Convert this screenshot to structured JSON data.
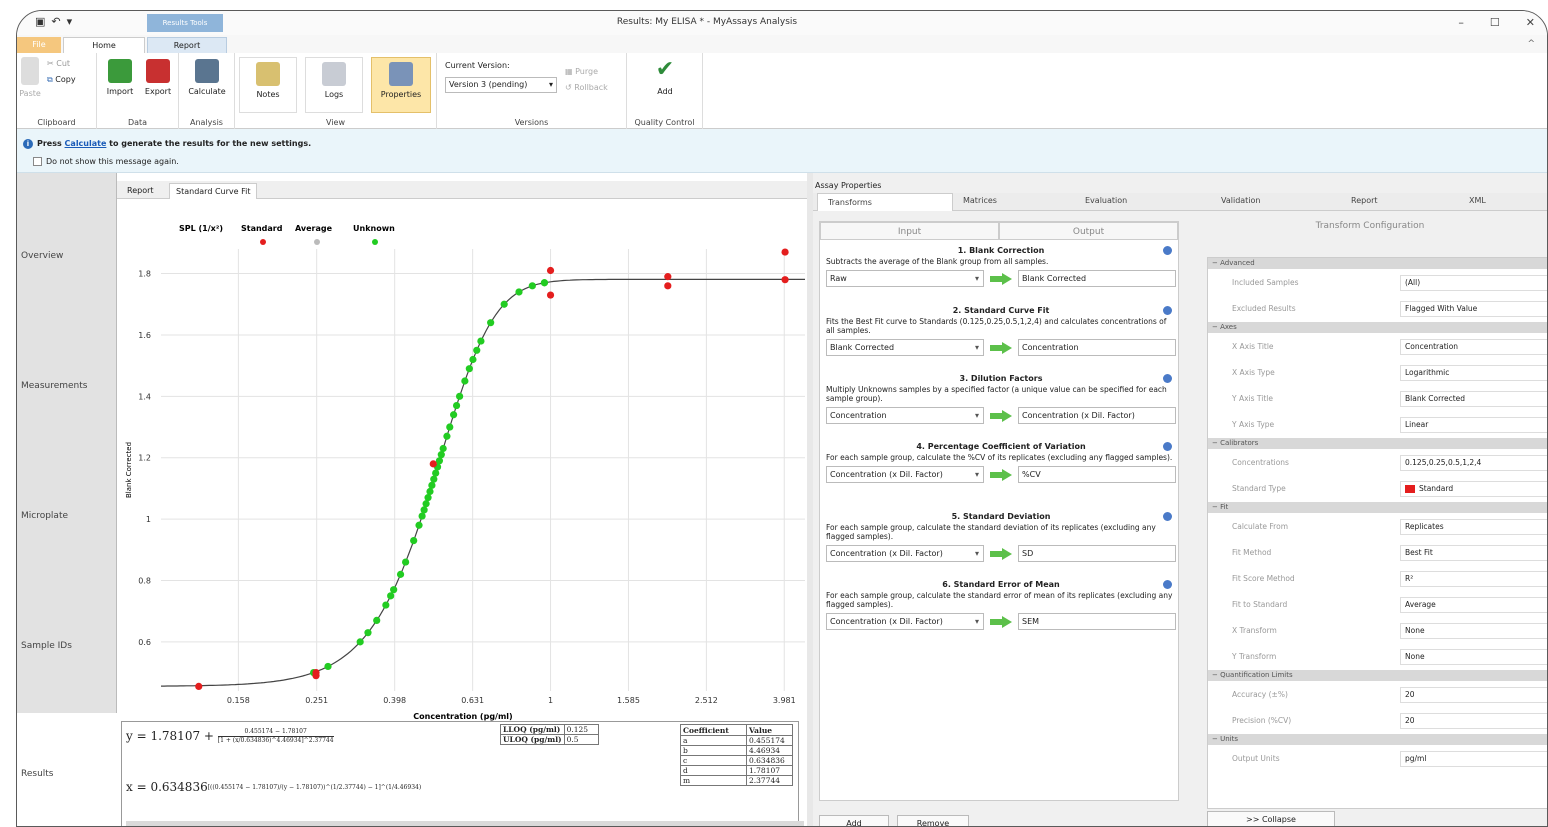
{
  "window": {
    "title": "Results: My ELISA * - MyAssays Analysis",
    "context_tab": "Results Tools",
    "min": "–",
    "max": "☐",
    "close": "✕"
  },
  "ribbon": {
    "tabs": {
      "file": "File",
      "home": "Home",
      "report": "Report"
    },
    "clipboard": {
      "cut": "Cut",
      "copy": "Copy",
      "paste": "Paste",
      "group": "Clipboard"
    },
    "data": {
      "import": "Import",
      "export": "Export",
      "group": "Data"
    },
    "analysis": {
      "calculate": "Calculate",
      "group": "Analysis"
    },
    "view": {
      "notes": "Notes",
      "logs": "Logs",
      "properties": "Properties",
      "group": "View"
    },
    "versions": {
      "current_label": "Current Version:",
      "current_value": "Version 3 (pending)",
      "purge": "Purge",
      "rollback": "Rollback",
      "group": "Versions"
    },
    "qc": {
      "add": "Add",
      "group": "Quality Control"
    }
  },
  "info": {
    "press": "Press ",
    "link": "Calculate",
    "rest": " to generate the results for the new settings.",
    "dont_show": "Do not show this message again."
  },
  "nav": {
    "overview": "Overview",
    "measurements": "Measurements",
    "microplate": "Microplate",
    "sample_ids": "Sample IDs",
    "results": "Results"
  },
  "center_tabs": {
    "report": "Report",
    "standard_curve_fit": "Standard Curve Fit"
  },
  "chart_data": {
    "type": "scatter",
    "legend": [
      "SPL (1/x²)",
      "Standard",
      "Average",
      "Unknown"
    ],
    "colors": {
      "standard": "#e41e1e",
      "unknown": "#22cc22",
      "curve": "#444444",
      "average": "#bbbbbb"
    },
    "xlabel": "Concentration (pg/ml)",
    "ylabel": "Blank Corrected",
    "x_scale": "log",
    "x_ticks": [
      "0.158",
      "0.251",
      "0.398",
      "0.631",
      "1",
      "1.585",
      "2.512",
      "3.981"
    ],
    "y_ticks": [
      "0.6",
      "0.8",
      "1",
      "1.2",
      "1.4",
      "1.6",
      "1.8"
    ],
    "xlim": [
      0.1,
      4.5
    ],
    "ylim": [
      0.44,
      1.88
    ],
    "curve": {
      "a": 0.455174,
      "b": 4.46934,
      "c": 0.634836,
      "d": 1.78107,
      "m": 2.37744
    },
    "standards": [
      {
        "x": 0.125,
        "y": 0.455
      },
      {
        "x": 0.25,
        "y": 0.5
      },
      {
        "x": 0.25,
        "y": 0.49
      },
      {
        "x": 0.5,
        "y": 1.18
      },
      {
        "x": 1,
        "y": 1.81
      },
      {
        "x": 1,
        "y": 1.73
      },
      {
        "x": 2,
        "y": 1.79
      },
      {
        "x": 2,
        "y": 1.76
      },
      {
        "x": 4,
        "y": 1.87
      },
      {
        "x": 4,
        "y": 1.78
      }
    ],
    "unknowns_y": [
      0.5,
      0.52,
      0.6,
      0.63,
      0.67,
      0.72,
      0.75,
      0.77,
      0.82,
      0.86,
      0.93,
      0.98,
      1.01,
      1.03,
      1.05,
      1.07,
      1.09,
      1.11,
      1.13,
      1.15,
      1.17,
      1.19,
      1.21,
      1.23,
      1.27,
      1.3,
      1.34,
      1.37,
      1.4,
      1.45,
      1.49,
      1.52,
      1.55,
      1.58,
      1.64,
      1.7,
      1.74,
      1.76,
      1.77,
      1.77
    ]
  },
  "equations": {
    "y_prefix": "y = 1.78107 + ",
    "y_num": "0.455174 − 1.78107",
    "y_den": "[1 + (x/0.634836)^4.46934]^2.37744",
    "x_prefix": "x = 0.634836",
    "x_body": "[((0.455174 − 1.78107)/(y − 1.78107))^(1/2.37744) − 1]^(1/4.46934)"
  },
  "limits": {
    "rows": [
      {
        "label": "LLOQ (pg/ml)",
        "value": "0.125"
      },
      {
        "label": "ULOQ (pg/ml)",
        "value": "0.5"
      }
    ]
  },
  "coefficients": {
    "header": [
      "Coefficient",
      "Value"
    ],
    "rows": [
      [
        "a",
        "0.455174"
      ],
      [
        "b",
        "4.46934"
      ],
      [
        "c",
        "0.634836"
      ],
      [
        "d",
        "1.78107"
      ],
      [
        "m",
        "2.37744"
      ]
    ]
  },
  "assay_properties": {
    "title": "Assay Properties",
    "tabs": [
      "Transforms",
      "Matrices",
      "Evaluation",
      "Validation",
      "Report",
      "XML"
    ],
    "io": {
      "input": "Input",
      "output": "Output"
    },
    "steps": [
      {
        "title": "1. Blank Correction",
        "desc": "Subtracts the average of the Blank group from all samples.",
        "input": "Raw",
        "output": "Blank Corrected"
      },
      {
        "title": "2. Standard Curve Fit",
        "desc": "Fits the Best Fit curve to Standards (0.125,0.25,0.5,1,2,4) and calculates concentrations of all samples.",
        "input": "Blank Corrected",
        "output": "Concentration"
      },
      {
        "title": "3. Dilution Factors",
        "desc": "Multiply Unknowns samples by a specified factor (a unique value can be specified for each sample group).",
        "input": "Concentration",
        "output": "Concentration (x Dil. Factor)"
      },
      {
        "title": "4. Percentage Coefficient of Variation",
        "desc": "For each sample group, calculate the %CV of its replicates (excluding any flagged samples).",
        "input": "Concentration (x Dil. Factor)",
        "output": "%CV"
      },
      {
        "title": "5. Standard Deviation",
        "desc": "For each sample group, calculate the standard deviation of its replicates (excluding any flagged samples).",
        "input": "Concentration (x Dil. Factor)",
        "output": "SD"
      },
      {
        "title": "6. Standard Error of Mean",
        "desc": "For each sample group, calculate the standard error of mean of its replicates (excluding any flagged samples).",
        "input": "Concentration (x Dil. Factor)",
        "output": "SEM"
      }
    ],
    "add": "Add",
    "remove": "Remove",
    "config_title": "Transform Configuration",
    "categories": {
      "advanced": "Advanced",
      "axes": "Axes",
      "calibrators": "Calibrators",
      "fit": "Fit",
      "quant": "Quantification Limits",
      "units": "Units"
    },
    "props": {
      "included_samples": {
        "name": "Included Samples",
        "value": "(All)"
      },
      "excluded_results": {
        "name": "Excluded Results",
        "value": "Flagged With Value"
      },
      "x_axis_title": {
        "name": "X Axis Title",
        "value": "Concentration"
      },
      "x_axis_type": {
        "name": "X Axis Type",
        "value": "Logarithmic"
      },
      "y_axis_title": {
        "name": "Y Axis Title",
        "value": "Blank Corrected"
      },
      "y_axis_type": {
        "name": "Y Axis Type",
        "value": "Linear"
      },
      "concentrations": {
        "name": "Concentrations",
        "value": "0.125,0.25,0.5,1,2,4"
      },
      "standard_type": {
        "name": "Standard Type",
        "value": "Standard"
      },
      "calculate_from": {
        "name": "Calculate From",
        "value": "Replicates"
      },
      "fit_method": {
        "name": "Fit Method",
        "value": "Best Fit"
      },
      "fit_score": {
        "name": "Fit Score Method",
        "value": "R²"
      },
      "fit_to_standard": {
        "name": "Fit to Standard",
        "value": "Average"
      },
      "x_transform": {
        "name": "X Transform",
        "value": "None"
      },
      "y_transform": {
        "name": "Y Transform",
        "value": "None"
      },
      "accuracy": {
        "name": "Accuracy (±%)",
        "value": "20"
      },
      "precision": {
        "name": "Precision (%CV)",
        "value": "20"
      },
      "output_units": {
        "name": "Output Units",
        "value": "pg/ml"
      }
    },
    "collapse": ">> Collapse"
  }
}
